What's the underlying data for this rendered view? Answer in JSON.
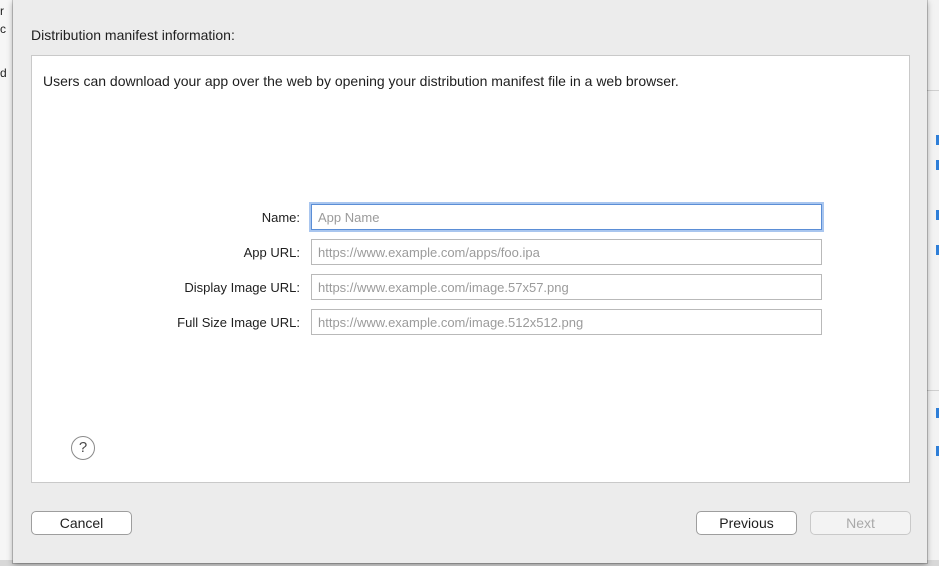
{
  "background": {
    "left_fragments": [
      "r",
      "c",
      "d"
    ]
  },
  "sheet": {
    "title": "Distribution manifest information:",
    "intro": "Users can download your app over the web by opening your distribution manifest file in a web browser.",
    "fields": [
      {
        "label": "Name:",
        "placeholder": "App Name",
        "value": "",
        "focused": true
      },
      {
        "label": "App URL:",
        "placeholder": "https://www.example.com/apps/foo.ipa",
        "value": ""
      },
      {
        "label": "Display Image URL:",
        "placeholder": "https://www.example.com/image.57x57.png",
        "value": ""
      },
      {
        "label": "Full Size Image URL:",
        "placeholder": "https://www.example.com/image.512x512.png",
        "value": ""
      }
    ],
    "help_symbol": "?",
    "buttons": {
      "cancel": "Cancel",
      "previous": "Previous",
      "next": "Next"
    }
  },
  "colors": {
    "focus_ring": "#5b8ed6",
    "background_accent": "#2f7fd8"
  },
  "icons": {
    "help": "help-circle-icon"
  }
}
